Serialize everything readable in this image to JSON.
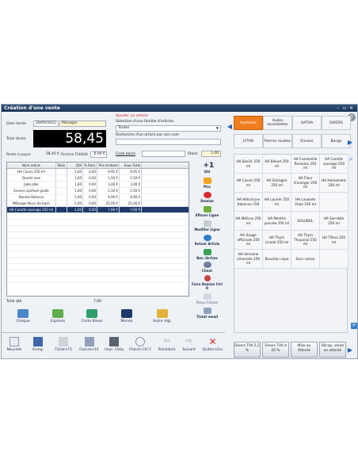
{
  "window": {
    "title": "Création d'une vente"
  },
  "header": {
    "date_label": "Date Vente",
    "date_value": "29/09/2022",
    "seller_value": "Manager",
    "total_label": "Total Vente",
    "total_value": "58,45",
    "rest_label": "Reste à payer",
    "rest_value": "58,45 €",
    "loyalty_label": "Remise Fidélité",
    "loyalty_value": "0,00 €"
  },
  "search": {
    "title": "Ajouter un article",
    "family_label": "Sélection d'une famille d'articles",
    "family_value": "Toutes",
    "name_search_label": "Recherche d'un article par son nom",
    "barcode_label": "Code barre",
    "stock_label": "Stock",
    "stock_value": "1,00"
  },
  "table": {
    "headers": [
      "Nom article",
      "Taille",
      "Qté",
      "% Rem.",
      "Prix Unitaire",
      "Sous Total"
    ],
    "rows": [
      [
        "HA Cassis 250 ml",
        "",
        "1,00",
        "0,00",
        "9,95 €",
        "9,95 €"
      ],
      [
        "Quartz rose",
        "",
        "1,00",
        "0,00",
        "1,50 €",
        "1,50 €"
      ],
      [
        "Jade pâle",
        "",
        "1,00",
        "0,00",
        "3,00 €",
        "3,00 €"
      ],
      [
        "Encens spirituel guide",
        "",
        "1,00",
        "0,00",
        "1,50 €",
        "1,50 €"
      ],
      [
        "Baume Balance",
        "",
        "1,00",
        "0,00",
        "9,90 €",
        "9,90 €"
      ],
      [
        "Mélange fleurs de bach",
        "",
        "1,00",
        "0,00",
        "25,00 €",
        "25,00 €"
      ],
      [
        "HA Carotte sauvage 250 ml",
        "",
        "1,00",
        "0,00",
        "7,60 €",
        "7,60 €"
      ]
    ],
    "total_qty_label": "Total qté",
    "total_qty_value": "7,00"
  },
  "side_actions": [
    "Qté",
    "Prix",
    "Remise",
    "Effacer Ligne",
    "Modifier Ligne",
    "Retour Article",
    "Bon /Arrhes",
    "Client",
    "Faire Remise Ctrl R",
    "Reçu Caisse",
    "Ticket email"
  ],
  "payments": [
    "Chèque",
    "Espèces",
    "Carte Bleue",
    "Monéo",
    "Autre régl."
  ],
  "families_row1": [
    "Hydrolats",
    "Huiles essentielles",
    "HATHA",
    "DIVERS"
  ],
  "families_row2": [
    "LITHO",
    "Pierres roulées",
    "Encens",
    "Bangs"
  ],
  "products": [
    [
      "HA Basilic 250 ml",
      "HA Bleuet 250 ml",
      "HA Camomille Romaine 250 ml",
      "HA Carotte sauvage 250 ml"
    ],
    [
      "HA Cassis 250 ml",
      "HA Estragon 250 ml",
      "HA Fleur d'oranger 200 ml",
      "HA Hamamelis 250 ml"
    ],
    [
      "HA Hélichryse Italienne 250",
      "HA Laurier 250 ml",
      "HA Lavande Vraie 250 ml",
      ""
    ],
    [
      "HA Mélisse 250 ml",
      "HA Menthe poivrée 250 ml",
      "SOLUBOL",
      "HA Sarriette 250 ml"
    ],
    [
      "HA Sauge officinale 250 ml",
      "HA Thym Linalol 250 ml",
      "HA Thym Thuyanol 250 ml",
      "HA Tilleul 250 ml"
    ],
    [
      "HA Verveine citronnée 250 ml",
      "Bouchon vapo",
      "Sacs caisse",
      ""
    ]
  ],
  "toolbar": [
    "Nouvelle",
    "Enreg.",
    "Ticket+F3",
    "Facture+F4",
    "Impr. Chèq",
    "Cherch.Ctrl F",
    "Précédent",
    "Suivant",
    "Quitter+Esc"
  ],
  "vat_buttons": [
    "Divers TVA 5,5 %",
    "Divers TVA à 20 %",
    "Mise en Attente",
    "Récup. vente en attente"
  ],
  "colors": {
    "accent": "#f07d1e",
    "title": "#1c3556",
    "selection": "#1d3a6b",
    "total_bg": "#000000"
  }
}
